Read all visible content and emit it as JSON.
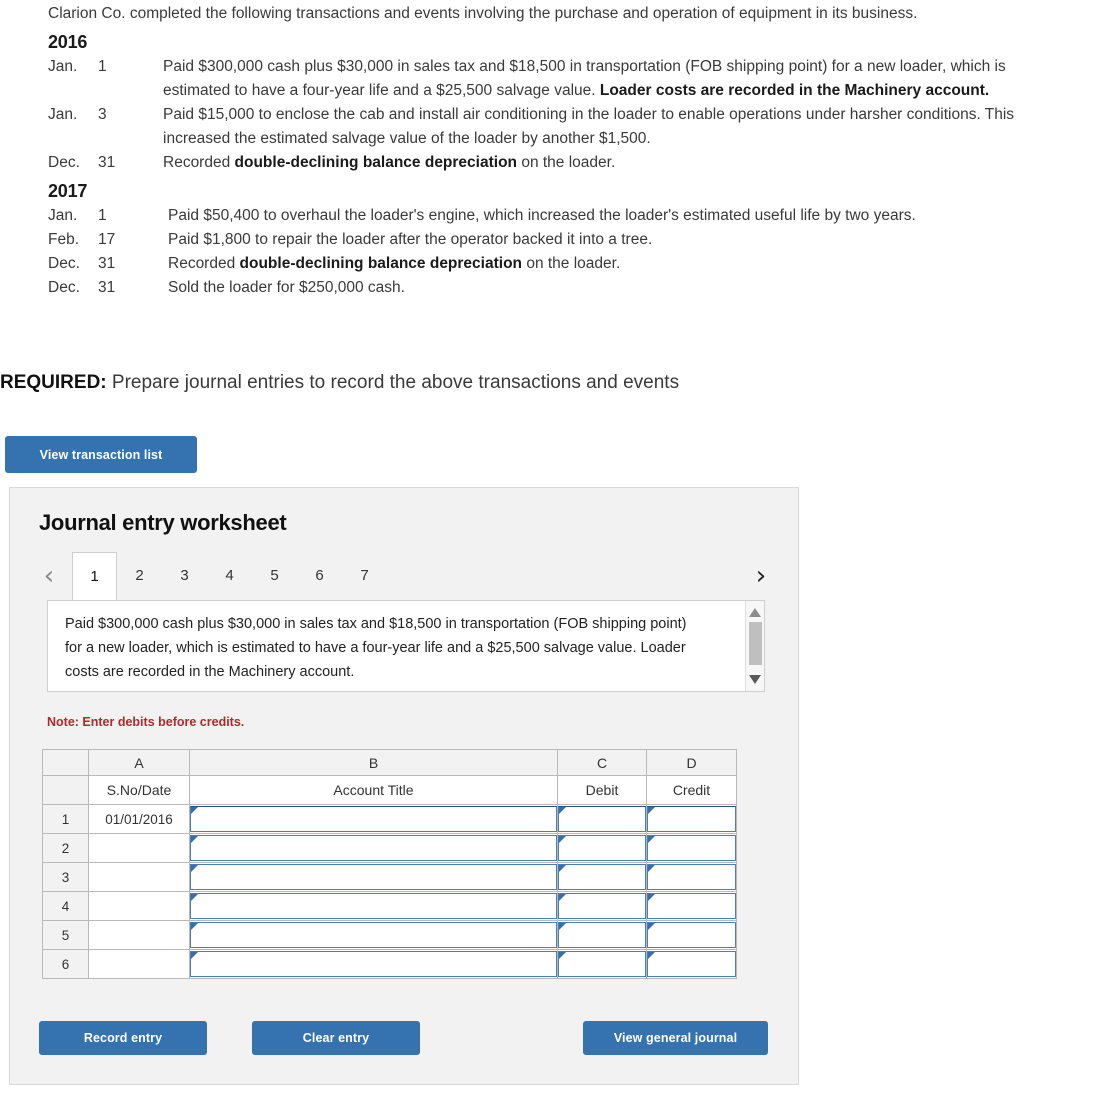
{
  "problem": {
    "intro": "Clarion Co. completed the following transactions and events involving the purchase and operation of equipment in its business.",
    "sections": [
      {
        "year": "2016",
        "rows": [
          {
            "month": "Jan.",
            "day": "1",
            "desc_pre": "Paid $300,000 cash plus $30,000 in sales tax and $18,500 in transportation (FOB shipping point) for a new loader, which is estimated to have a four-year life and a $25,500 salvage value. ",
            "desc_bold": "Loader costs are recorded in the Machinery account.",
            "desc_post": ""
          },
          {
            "month": "Jan.",
            "day": "3",
            "desc_pre": "Paid $15,000 to enclose the cab and install air conditioning in the loader to enable operations under harsher conditions. This increased the estimated salvage value of the loader by another $1,500.",
            "desc_bold": "",
            "desc_post": ""
          },
          {
            "month": "Dec.",
            "day": "31",
            "desc_pre": "Recorded ",
            "desc_bold": "double-declining balance depreciation",
            "desc_post": " on the loader."
          }
        ]
      },
      {
        "year": "2017",
        "rows": [
          {
            "month": "Jan.",
            "day": "1",
            "desc_pre": "Paid $50,400 to overhaul the loader's engine, which increased the loader's estimated useful life by two years.",
            "desc_bold": "",
            "desc_post": ""
          },
          {
            "month": "Feb.",
            "day": "17",
            "desc_pre": "Paid $1,800 to repair the loader after the operator backed it into a tree.",
            "desc_bold": "",
            "desc_post": ""
          },
          {
            "month": "Dec.",
            "day": "31",
            "desc_pre": "Recorded ",
            "desc_bold": "double-declining balance depreciation",
            "desc_post": " on the loader."
          },
          {
            "month": "Dec.",
            "day": "31",
            "desc_pre": "Sold the loader for $250,000 cash.",
            "desc_bold": "",
            "desc_post": ""
          }
        ]
      }
    ],
    "required_label": "REQUIRED:",
    "required_text": " Prepare journal entries to record the above transactions and events"
  },
  "buttons": {
    "view_transaction_list": "View transaction list",
    "record_entry": "Record entry",
    "clear_entry": "Clear entry",
    "view_general_journal": "View general journal"
  },
  "worksheet": {
    "title": "Journal entry worksheet",
    "prev_icon": "chevron-left",
    "next_icon": "chevron-right",
    "prev_glyph": "‹",
    "next_glyph": "›",
    "tabs": [
      "1",
      "2",
      "3",
      "4",
      "5",
      "6",
      "7"
    ],
    "active_tab": "1",
    "description": "Paid $300,000 cash plus $30,000 in sales tax and $18,500 in transportation (FOB shipping point) for a new loader, which is estimated to have a four-year life and a $25,500 salvage value. Loader costs are recorded in the Machinery account.",
    "note": "Note: Enter debits before credits.",
    "grid": {
      "column_letters": [
        "",
        "A",
        "B",
        "C",
        "D"
      ],
      "column_labels": [
        "",
        "S.No/Date",
        "Account Title",
        "Debit",
        "Credit"
      ],
      "rows": [
        {
          "num": "1",
          "date": "01/01/2016",
          "account": "",
          "debit": "",
          "credit": ""
        },
        {
          "num": "2",
          "date": "",
          "account": "",
          "debit": "",
          "credit": ""
        },
        {
          "num": "3",
          "date": "",
          "account": "",
          "debit": "",
          "credit": ""
        },
        {
          "num": "4",
          "date": "",
          "account": "",
          "debit": "",
          "credit": ""
        },
        {
          "num": "5",
          "date": "",
          "account": "",
          "debit": "",
          "credit": ""
        },
        {
          "num": "6",
          "date": "",
          "account": "",
          "debit": "",
          "credit": ""
        }
      ]
    }
  },
  "colors": {
    "button_blue": "#3572b0",
    "note_red": "#b02a2a",
    "panel_bg": "#f2f2f2",
    "cell_border_blue": "#4a7ebb"
  }
}
